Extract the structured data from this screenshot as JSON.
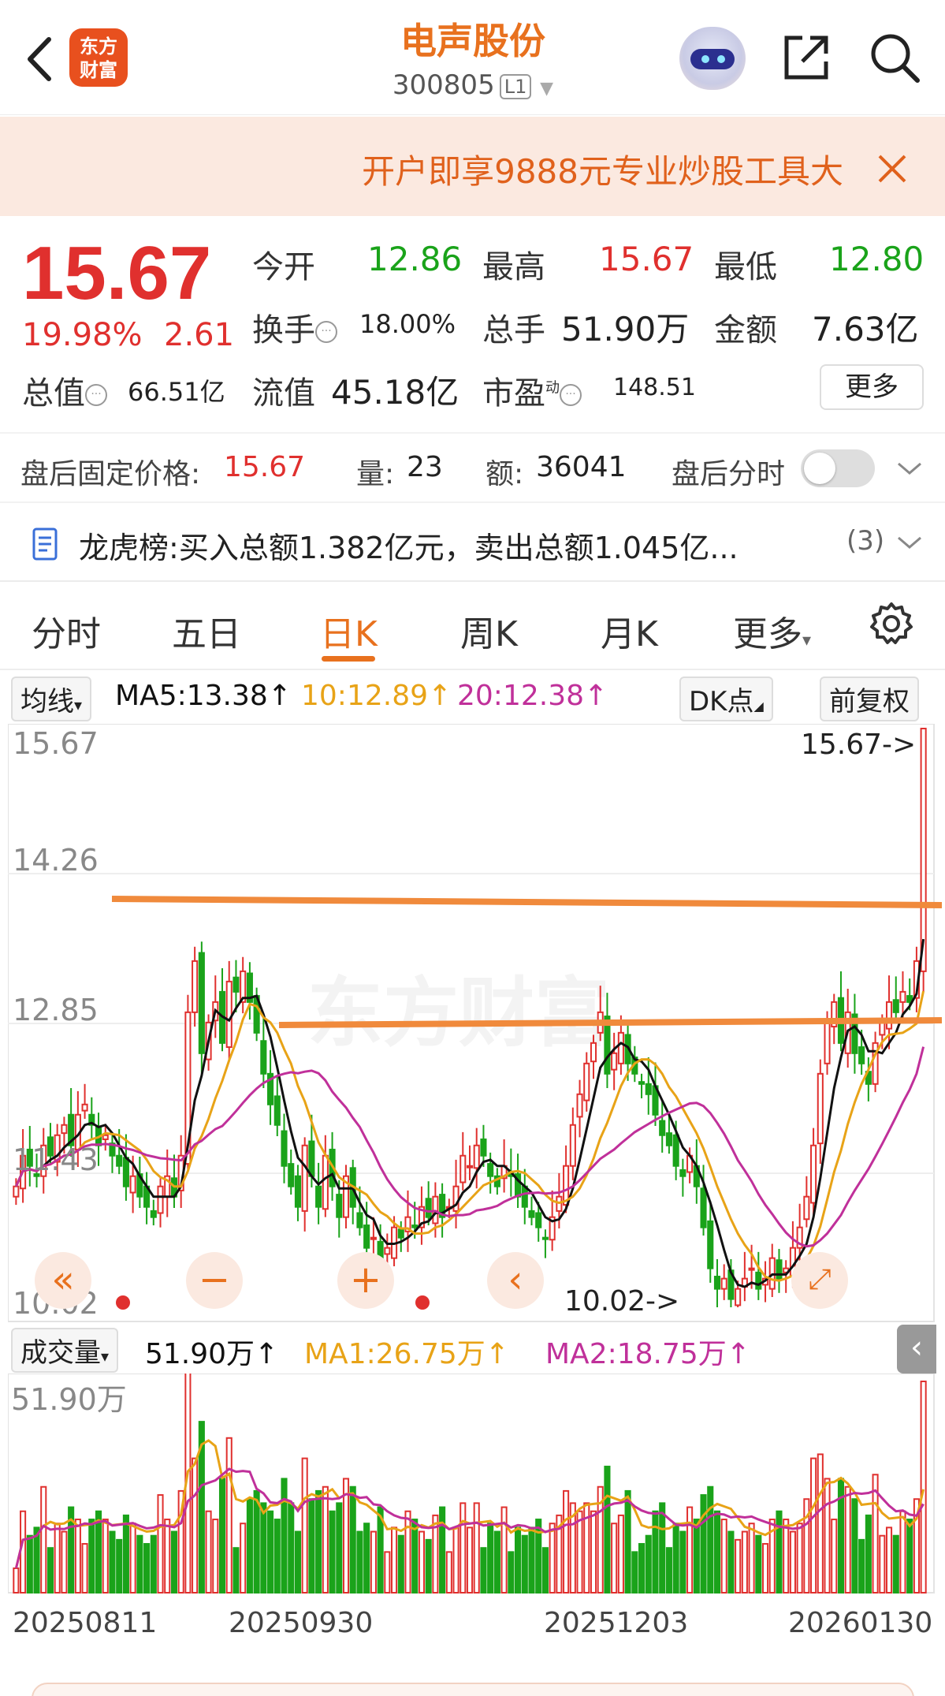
{
  "header": {
    "title": "电声股份",
    "code": "300805",
    "level": "L1",
    "logo_text_1": "东方",
    "logo_text_2": "财富"
  },
  "banner": {
    "text": "开户即享9888元专业炒股工具大"
  },
  "quote": {
    "price": "15.67",
    "change_pct": "19.98%",
    "change": "2.61",
    "open_label": "今开",
    "open": "12.86",
    "high_label": "最高",
    "high": "15.67",
    "low_label": "最低",
    "low": "12.80",
    "turnover_label": "换手",
    "turnover": "18.00%",
    "volume_label": "总手",
    "volume": "51.90万",
    "amount_label": "金额",
    "amount": "7.63亿",
    "mktcap_label": "总值",
    "mktcap": "66.51亿",
    "float_label": "流值",
    "float": "45.18亿",
    "pe_label": "市盈",
    "pe_sup": "动",
    "pe": "148.51",
    "more_label": "更多"
  },
  "after_hours": {
    "label": "盘后固定价格:",
    "price": "15.67",
    "vol_label": "量:",
    "vol": "23",
    "amt_label": "额:",
    "amt": "36041",
    "toggle_label": "盘后分时"
  },
  "lhb": {
    "label": "龙虎榜:",
    "text": "买入总额1.382亿元，卖出总额1.045亿...",
    "count": "(3)"
  },
  "tabs": [
    "分时",
    "五日",
    "日K",
    "周K",
    "月K",
    "更多"
  ],
  "ma_row": {
    "selector": "均线",
    "ma5": "MA5:13.38↑",
    "ma10": "10:12.89↑",
    "ma20": "20:12.38↑",
    "dk": "DK点",
    "adjust": "前复权"
  },
  "colors": {
    "up": "#e0302e",
    "down": "#1aa31a",
    "ma5": "#111111",
    "ma10": "#e8a317",
    "ma20": "#c0309a",
    "accent": "#e8711e"
  },
  "kline": {
    "price_ticks": [
      "15.67",
      "14.26",
      "12.85",
      "11.43",
      "10.02"
    ],
    "high_marker": "15.67->",
    "low_marker": "10.02->",
    "watermark": "东方财富"
  },
  "volume": {
    "selector": "成交量",
    "value": "51.90万↑",
    "ma1": "MA1:26.75万↑",
    "ma2": "MA2:18.75万↑",
    "max_tick": "51.90万",
    "date_labels": [
      "20250811",
      "20250930",
      "20251203",
      "20260130"
    ]
  },
  "chart_data": {
    "type": "candlestick",
    "ylim": [
      10.02,
      15.67
    ],
    "closes": [
      11.2,
      11.5,
      11.4,
      11.3,
      11.6,
      11.5,
      11.7,
      11.8,
      11.6,
      11.9,
      12.0,
      11.8,
      11.6,
      11.7,
      11.5,
      11.4,
      11.2,
      11.3,
      11.1,
      11.0,
      10.9,
      11.2,
      11.3,
      11.1,
      11.5,
      12.9,
      13.4,
      12.5,
      12.8,
      13.0,
      12.6,
      13.2,
      13.1,
      13.3,
      13.0,
      12.7,
      12.3,
      12.0,
      11.8,
      11.4,
      11.2,
      11.0,
      11.6,
      11.3,
      11.0,
      11.5,
      11.2,
      10.9,
      11.3,
      11.0,
      10.8,
      10.6,
      10.7,
      10.5,
      10.6,
      10.8,
      10.7,
      10.9,
      10.8,
      11.0,
      10.9,
      11.1,
      10.9,
      11.0,
      11.2,
      11.5,
      11.4,
      11.6,
      11.5,
      11.3,
      11.2,
      11.4,
      11.3,
      11.1,
      11.0,
      10.9,
      10.8,
      10.7,
      10.9,
      11.1,
      11.4,
      11.8,
      12.1,
      12.4,
      12.6,
      12.9,
      12.3,
      12.5,
      12.7,
      12.4,
      12.3,
      12.2,
      12.1,
      11.9,
      11.7,
      11.6,
      11.4,
      11.3,
      11.5,
      11.2,
      10.8,
      10.4,
      10.2,
      10.3,
      10.1,
      10.2,
      10.3,
      10.4,
      10.2,
      10.3,
      10.5,
      10.3,
      10.4,
      10.6,
      10.8,
      11.1,
      11.6,
      12.3,
      12.8,
      13.0,
      12.6,
      12.9,
      12.5,
      12.4,
      12.2,
      12.6,
      12.8,
      13.0,
      12.9,
      13.1,
      13.0,
      13.4,
      15.67
    ],
    "volume_ylim": [
      0,
      51.9
    ]
  }
}
